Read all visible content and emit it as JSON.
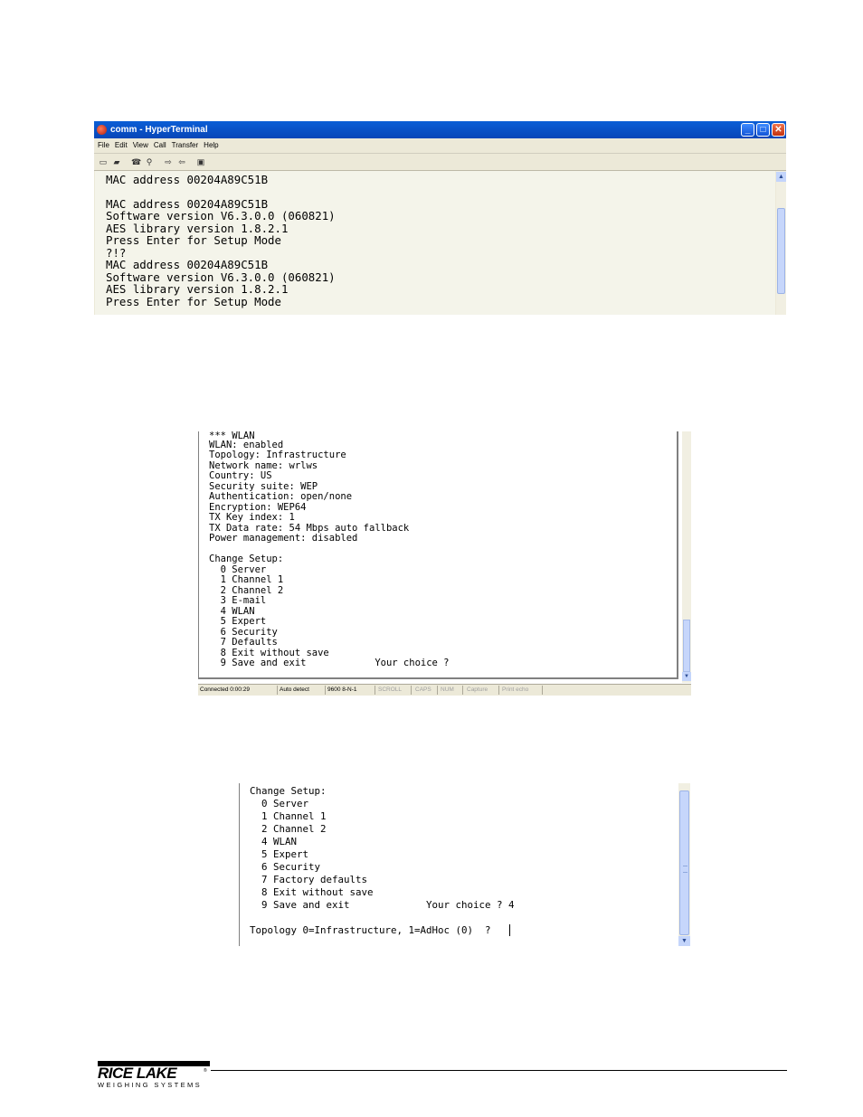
{
  "hyperterminal": {
    "title": "comm - HyperTerminal",
    "window_buttons": {
      "minimize": "_",
      "maximize": "□",
      "close": "✕"
    },
    "menu": [
      "File",
      "Edit",
      "View",
      "Call",
      "Transfer",
      "Help"
    ],
    "toolbar_icons": [
      "new-icon",
      "open-icon",
      "phone-icon",
      "disconnect-icon",
      "send-icon",
      "receive-icon",
      "properties-icon"
    ],
    "lines": [
      "MAC address 00204A89C51B",
      "",
      "MAC address 00204A89C51B",
      "Software version V6.3.0.0 (060821)",
      "AES library version 1.8.2.1",
      "Press Enter for Setup Mode",
      "?!?",
      "MAC address 00204A89C51B",
      "Software version V6.3.0.0 (060821)",
      "AES library version 1.8.2.1",
      "Press Enter for Setup Mode"
    ]
  },
  "wlan_terminal": {
    "lines": [
      "*** WLAN",
      "WLAN: enabled",
      "Topology: Infrastructure",
      "Network name: wrlws",
      "Country: US",
      "Security suite: WEP",
      "Authentication: open/none",
      "Encryption: WEP64",
      "TX Key index: 1",
      "TX Data rate: 54 Mbps auto fallback",
      "Power management: disabled",
      "",
      "Change Setup:",
      "  0 Server",
      "  1 Channel 1",
      "  2 Channel 2",
      "  3 E-mail",
      "  4 WLAN",
      "  5 Expert",
      "  6 Security",
      "  7 Defaults",
      "  8 Exit without save",
      "  9 Save and exit            Your choice ?"
    ],
    "status_bar": {
      "connected": "Connected 0:00:29",
      "detect": "Auto detect",
      "settings": "9600 8-N-1",
      "scroll": "SCROLL",
      "caps": "CAPS",
      "num": "NUM",
      "capture": "Capture",
      "print_echo": "Print echo"
    }
  },
  "topology_terminal": {
    "lines": [
      "Change Setup:",
      "  0 Server",
      "  1 Channel 1",
      "  2 Channel 2",
      "  4 WLAN",
      "  5 Expert",
      "  6 Security",
      "  7 Factory defaults",
      "  8 Exit without save",
      "  9 Save and exit             Your choice ? 4",
      "",
      "Topology 0=Infrastructure, 1=AdHoc (0)  ? "
    ]
  },
  "footer": {
    "logo_main": "RICE LAKE",
    "logo_sub": "WEIGHING SYSTEMS",
    "logo_mark": "®"
  }
}
